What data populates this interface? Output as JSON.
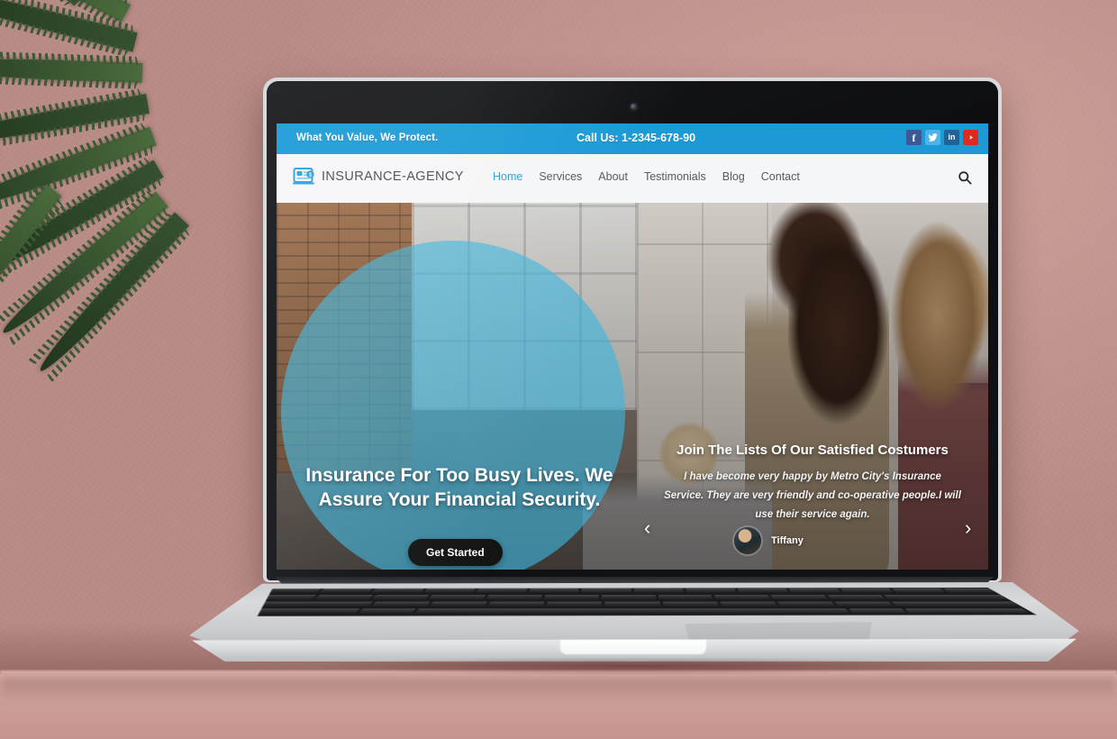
{
  "site": {
    "topbar": {
      "tagline": "What You Value, We Protect.",
      "phone": "Call Us: 1-2345-678-90",
      "socials": [
        {
          "name": "facebook-icon",
          "label": "f",
          "color": "#3b5998"
        },
        {
          "name": "twitter-icon",
          "label": "t",
          "color": "#4eb3e8"
        },
        {
          "name": "linkedin-icon",
          "label": "in",
          "color": "#1f6397"
        },
        {
          "name": "youtube-icon",
          "label": "▶",
          "color": "#e02a1f"
        }
      ],
      "background_color": "#1b9ad6"
    },
    "navbar": {
      "logo_icon": "insurance-document-icon",
      "logo_text": "INSURANCE-AGENCY",
      "search_icon": "search-icon",
      "links": [
        {
          "label": "Home",
          "active": true
        },
        {
          "label": "Services",
          "active": false
        },
        {
          "label": "About",
          "active": false
        },
        {
          "label": "Testimonials",
          "active": false
        },
        {
          "label": "Blog",
          "active": false
        },
        {
          "label": "Contact",
          "active": false
        }
      ],
      "active_color": "#2f9fd8"
    },
    "hero": {
      "heading": "Insurance For Too Busy Lives. We Assure Your Financial Security.",
      "cta_label": "Get Started",
      "circle_color": "#3bb6e0"
    },
    "testimonial": {
      "title": "Join The Lists Of Our Satisfied Costumers",
      "quote": "I have become very happy by Metro City's Insurance Service. They are very friendly and co-operative people.I will use their service again.",
      "author": "Tiffany",
      "avatar_icon": "avatar",
      "prev_icon": "‹",
      "next_icon": "›"
    }
  },
  "device": {
    "type": "laptop",
    "webcam_icon": "webcam-icon"
  },
  "scene": {
    "wall_color": "#c4978f",
    "counter_color": "#d7aaa4",
    "plant": "palm-fronds"
  }
}
